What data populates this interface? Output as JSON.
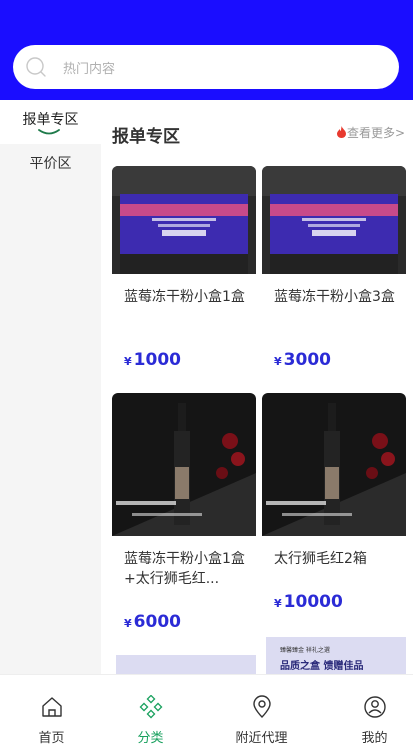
{
  "search": {
    "placeholder": "热门内容"
  },
  "sidebar": {
    "items": [
      {
        "label": "报单专区",
        "active": true
      },
      {
        "label": "平价区",
        "active": false
      }
    ]
  },
  "section": {
    "title": "报单专区",
    "more": "查看更多>"
  },
  "products": [
    {
      "name": "蓝莓冻干粉小盒1盒",
      "currency": "¥",
      "price": "1000",
      "image": "blue-product-box"
    },
    {
      "name": "蓝莓冻干粉小盒3盒",
      "currency": "¥",
      "price": "3000",
      "image": "blue-product-box"
    },
    {
      "name": "蓝莓冻干粉小盒1盒+太行狮毛红...",
      "currency": "¥",
      "price": "6000",
      "image": "wine-bottle"
    },
    {
      "name": "太行狮毛红2箱",
      "currency": "¥",
      "price": "10000",
      "image": "wine-bottle"
    }
  ],
  "partial_cards": [
    {
      "line1": "",
      "line2": ""
    },
    {
      "line1": "臻馨臻金 祥礼之選",
      "line2": "品质之盒 馈赠佳品"
    }
  ],
  "tabbar": {
    "items": [
      {
        "label": "首页",
        "icon": "home-icon"
      },
      {
        "label": "分类",
        "icon": "category-icon",
        "active": true
      },
      {
        "label": "附近代理",
        "icon": "location-pin-icon"
      },
      {
        "label": "我的",
        "icon": "user-icon"
      }
    ]
  },
  "colors": {
    "header": "#1a0dff",
    "price": "#2b2bd6",
    "active_tab": "#1aa15f",
    "flame": "#e83a2f"
  }
}
